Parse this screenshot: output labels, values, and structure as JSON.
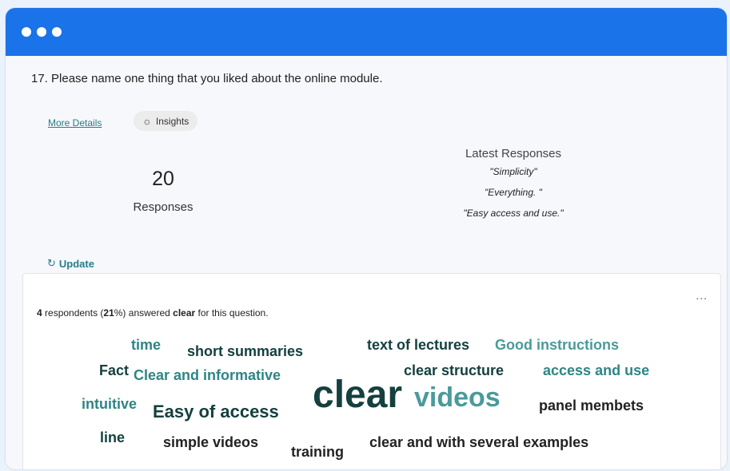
{
  "question": {
    "number": "17.",
    "text": "Please name one thing that you liked about the online module."
  },
  "links": {
    "more_details": "More Details",
    "insights": "Insights",
    "insights_icon": "lightbulb-icon"
  },
  "responses": {
    "count": "20",
    "label": "Responses"
  },
  "latest": {
    "title": "Latest Responses",
    "items": [
      "\"Simplicity\"",
      "\"Everything. \"",
      "\"Easy access and use.\""
    ]
  },
  "update": {
    "label": "Update",
    "icon": "refresh-icon"
  },
  "summary": {
    "count": "4",
    "pre": " respondents (",
    "percent": "21",
    "mid": "%) answered ",
    "word": "clear",
    "post": " for this question."
  },
  "more_menu": "...",
  "colors": {
    "titlebar": "#1a73e8",
    "dark_word": "#14403f",
    "teal_word": "#2e8585",
    "light_teal_word": "#4a9a9a",
    "black_word": "#222222"
  },
  "word_cloud": [
    {
      "text": "time"
    },
    {
      "text": "short summaries"
    },
    {
      "text": "text of lectures"
    },
    {
      "text": "Good instructions"
    },
    {
      "text": "Fact"
    },
    {
      "text": "Clear and informative"
    },
    {
      "text": "clear structure"
    },
    {
      "text": "access and use"
    },
    {
      "text": "intuitive"
    },
    {
      "text": "Easy of access"
    },
    {
      "text": "clear"
    },
    {
      "text": "videos"
    },
    {
      "text": "panel membets"
    },
    {
      "text": "line"
    },
    {
      "text": "simple videos"
    },
    {
      "text": "training"
    },
    {
      "text": "clear and with several examples"
    }
  ]
}
